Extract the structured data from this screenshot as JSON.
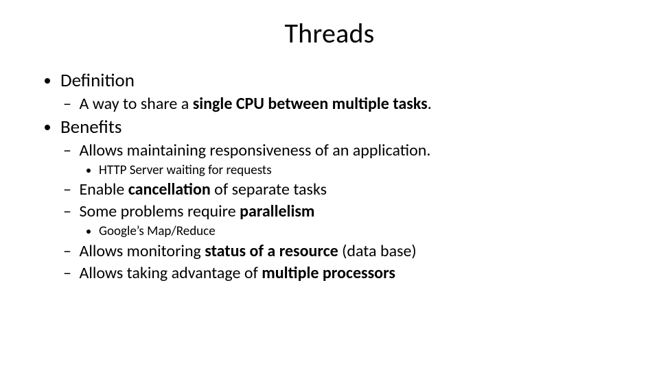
{
  "slide": {
    "title": "Threads",
    "b1": {
      "label": "Definition",
      "s1": {
        "pre": "A way to share a ",
        "bold": "single CPU between multiple tasks",
        "post": "."
      }
    },
    "b2": {
      "label": "Benefits",
      "s1": {
        "text": "Allows maintaining responsiveness of an application.",
        "ss1": "HTTP Server waiting for requests"
      },
      "s2": {
        "pre": "Enable ",
        "bold": "cancellation",
        "post": " of separate tasks"
      },
      "s3": {
        "pre": "Some problems require ",
        "bold": "parallelism",
        "post": "",
        "ss1": "Google’s Map/Reduce"
      },
      "s4": {
        "pre": "Allows monitoring ",
        "bold": "status of a resource",
        "post": " (data base)"
      },
      "s5": {
        "pre": "Allows taking advantage of ",
        "bold": "multiple processors",
        "post": ""
      }
    }
  }
}
